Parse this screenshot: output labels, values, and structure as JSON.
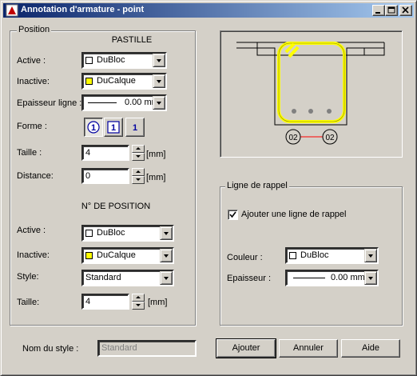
{
  "window": {
    "title": "Annotation d'armature - point"
  },
  "position_group": {
    "label": "Position",
    "pastille": {
      "heading": "PASTILLE",
      "active_label": "Active :",
      "active_value": "DuBloc",
      "active_color": "#ffffff",
      "inactive_label": "Inactive:",
      "inactive_value": "DuCalque",
      "inactive_color": "#ffff00",
      "lineweight_label": "Epaisseur ligne :",
      "lineweight_value": "0.00 mr",
      "forme_label": "Forme :",
      "taille_label": "Taille :",
      "taille_value": "4",
      "taille_unit": "[mm]",
      "distance_label": "Distance:",
      "distance_value": "0",
      "distance_unit": "[mm]"
    },
    "numero": {
      "heading": "N° DE POSITION",
      "active_label": "Active :",
      "active_value": "DuBloc",
      "active_color": "#ffffff",
      "inactive_label": "Inactive:",
      "inactive_value": "DuCalque",
      "inactive_color": "#ffff00",
      "style_label": "Style:",
      "style_value": "Standard",
      "taille_label": "Taille:",
      "taille_value": "4",
      "taille_unit": "[mm]"
    }
  },
  "preview": {
    "labels": [
      "02",
      "02"
    ],
    "colors": {
      "stirrup": "#ffff00",
      "leader": "#ff0000"
    }
  },
  "ligne_group": {
    "label": "Ligne de rappel",
    "checkbox_label": "Ajouter une ligne de rappel",
    "checked": true,
    "couleur_label": "Couleur :",
    "couleur_value": "DuBloc",
    "couleur_color": "#ffffff",
    "epaisseur_label": "Epaisseur :",
    "epaisseur_value": "0.00 mm"
  },
  "footer": {
    "style_name_label": "Nom du style :",
    "style_name_value": "Standard",
    "add_button": "Ajouter",
    "cancel_button": "Annuler",
    "help_button": "Aide"
  }
}
